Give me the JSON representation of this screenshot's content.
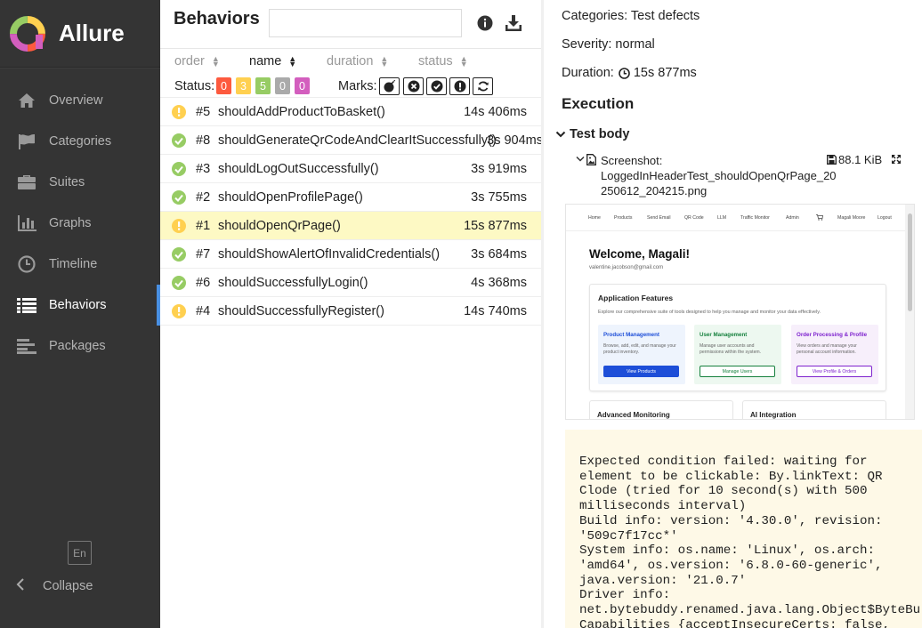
{
  "app": {
    "name": "Allure"
  },
  "sidebar": {
    "items": [
      {
        "label": "Overview",
        "icon": "home-icon"
      },
      {
        "label": "Categories",
        "icon": "flag-icon"
      },
      {
        "label": "Suites",
        "icon": "briefcase-icon"
      },
      {
        "label": "Graphs",
        "icon": "bar-chart-icon"
      },
      {
        "label": "Timeline",
        "icon": "clock-icon"
      },
      {
        "label": "Behaviors",
        "icon": "list-icon",
        "active": true
      },
      {
        "label": "Packages",
        "icon": "align-left-icon"
      }
    ],
    "lang": "En",
    "collapse": "Collapse"
  },
  "behaviors": {
    "title": "Behaviors",
    "search_value": "",
    "sort": [
      {
        "label": "order"
      },
      {
        "label": "name",
        "active": true
      },
      {
        "label": "duration"
      },
      {
        "label": "status"
      }
    ],
    "status_label": "Status:",
    "status_counts": [
      "0",
      "3",
      "5",
      "0",
      "0"
    ],
    "status_colors": [
      "#fd5a3e",
      "#ffd050",
      "#97cc64",
      "#aaaaaa",
      "#d35ebe"
    ],
    "marks_label": "Marks:",
    "marks": [
      "flaky-bomb-icon",
      "new-failed-icon",
      "new-passed-icon",
      "new-broken-icon",
      "retries-icon"
    ],
    "tests": [
      {
        "status": "broken",
        "num": "#5",
        "name": "shouldAddProductToBasket()",
        "duration": "14s 406ms"
      },
      {
        "status": "passed",
        "num": "#8",
        "name": "shouldGenerateQrCodeAndClearItSuccessfully()",
        "duration": "3s 904ms"
      },
      {
        "status": "passed",
        "num": "#3",
        "name": "shouldLogOutSuccessfully()",
        "duration": "3s 919ms"
      },
      {
        "status": "passed",
        "num": "#2",
        "name": "shouldOpenProfilePage()",
        "duration": "3s 755ms"
      },
      {
        "status": "broken",
        "num": "#1",
        "name": "shouldOpenQrPage()",
        "duration": "15s 877ms",
        "selected": true
      },
      {
        "status": "passed",
        "num": "#7",
        "name": "shouldShowAlertOfInvalidCredentials()",
        "duration": "3s 684ms"
      },
      {
        "status": "passed",
        "num": "#6",
        "name": "shouldSuccessfullyLogin()",
        "duration": "4s 368ms"
      },
      {
        "status": "broken",
        "num": "#4",
        "name": "shouldSuccessfullyRegister()",
        "duration": "14s 740ms"
      }
    ]
  },
  "details": {
    "categories": "Categories: Test defects",
    "severity": "Severity: normal",
    "duration_label": "Duration:",
    "duration_value": "15s 877ms",
    "execution_title": "Execution",
    "test_body": "Test body",
    "attachment": {
      "name_line1": "Screenshot:",
      "name_line2": "LoggedInHeaderTest_shouldOpenQrPage_20",
      "name_line3": "250612_204215.png",
      "size": "88.1 KiB"
    },
    "screenshot": {
      "nav": [
        "Home",
        "Products",
        "Send Email",
        "QR Code",
        "LLM",
        "Traffic Monitor",
        "Admin",
        "Magali Moore",
        "Logout"
      ],
      "welcome": "Welcome, Magali!",
      "email": "valentine.jacobson@gmail.com",
      "features_title": "Application Features",
      "features_desc": "Explore our comprehensive suite of tools designed to help you manage and monitor your data effectively.",
      "features": [
        {
          "title": "Product Management",
          "desc": "Browse, add, edit, and manage your product inventory.",
          "button": "View Products"
        },
        {
          "title": "User Management",
          "desc": "Manage user accounts and permissions within the system.",
          "button": "Manage Users"
        },
        {
          "title": "Order Processing & Profile",
          "desc": "View orders and manage your personal account information.",
          "button": "View Profile & Orders"
        }
      ],
      "card_advanced": "Advanced Monitoring",
      "card_ai": "AI Integration"
    },
    "error_lines": [
      "Expected condition failed: waiting for",
      "element to be clickable: By.linkText: QR",
      "Clode (tried for 10 second(s) with 500",
      "milliseconds interval)",
      "Build info: version: '4.30.0', revision:",
      "'509c7f17cc*'",
      "System info: os.name: 'Linux', os.arch:",
      "'amd64', os.version: '6.8.0-60-generic',",
      "java.version: '21.0.7'",
      "Driver info:",
      "net.bytebuddy.renamed.java.lang.Object$ByteBu",
      "Capabilities {acceptInsecureCerts: false,"
    ]
  }
}
